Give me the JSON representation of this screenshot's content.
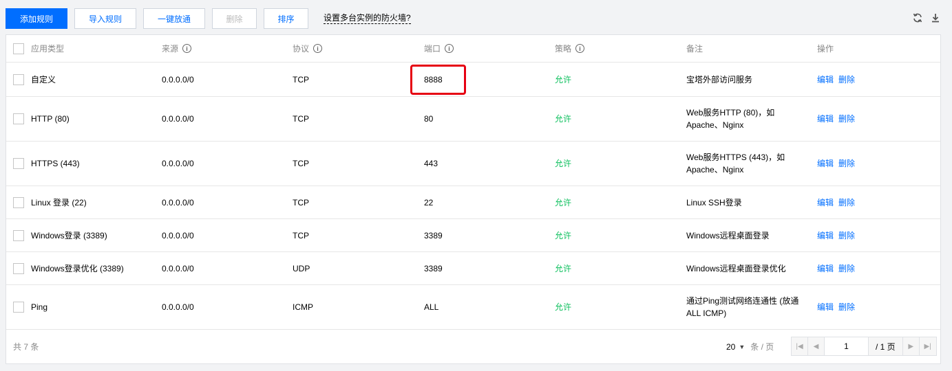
{
  "toolbar": {
    "add_label": "添加规则",
    "import_label": "导入规则",
    "open_all_label": "一键放通",
    "delete_label": "删除",
    "sort_label": "排序",
    "help_link": "设置多台实例的防火墙?",
    "refresh_icon": "refresh-icon",
    "download_icon": "download-icon"
  },
  "table": {
    "headers": {
      "type": "应用类型",
      "source": "来源",
      "protocol": "协议",
      "port": "端口",
      "policy": "策略",
      "note": "备注",
      "ops": "操作"
    },
    "info_glyph": "i",
    "rows": [
      {
        "type": "自定义",
        "source": "0.0.0.0/0",
        "protocol": "TCP",
        "port": "8888",
        "policy": "允许",
        "note": "宝塔外部访问服务",
        "edit": "编辑",
        "delete": "删除"
      },
      {
        "type": "HTTP (80)",
        "source": "0.0.0.0/0",
        "protocol": "TCP",
        "port": "80",
        "policy": "允许",
        "note": "Web服务HTTP (80)，如Apache、Nginx",
        "edit": "编辑",
        "delete": "删除"
      },
      {
        "type": "HTTPS (443)",
        "source": "0.0.0.0/0",
        "protocol": "TCP",
        "port": "443",
        "policy": "允许",
        "note": "Web服务HTTPS (443)，如Apache、Nginx",
        "edit": "编辑",
        "delete": "删除"
      },
      {
        "type": "Linux 登录 (22)",
        "source": "0.0.0.0/0",
        "protocol": "TCP",
        "port": "22",
        "policy": "允许",
        "note": "Linux SSH登录",
        "edit": "编辑",
        "delete": "删除"
      },
      {
        "type": "Windows登录 (3389)",
        "source": "0.0.0.0/0",
        "protocol": "TCP",
        "port": "3389",
        "policy": "允许",
        "note": "Windows远程桌面登录",
        "edit": "编辑",
        "delete": "删除"
      },
      {
        "type": "Windows登录优化 (3389)",
        "source": "0.0.0.0/0",
        "protocol": "UDP",
        "port": "3389",
        "policy": "允许",
        "note": "Windows远程桌面登录优化",
        "edit": "编辑",
        "delete": "删除"
      },
      {
        "type": "Ping",
        "source": "0.0.0.0/0",
        "protocol": "ICMP",
        "port": "ALL",
        "policy": "允许",
        "note": "通过Ping测试网络连通性 (放通ALL ICMP)",
        "edit": "编辑",
        "delete": "删除"
      }
    ]
  },
  "footer": {
    "total": "共 7 条",
    "page_size": "20",
    "per_page": "条 / 页",
    "current_page": "1",
    "total_pages": "/ 1 页"
  },
  "colors": {
    "primary": "#006eff",
    "allow": "#0abf5b",
    "highlight": "#e60012"
  }
}
